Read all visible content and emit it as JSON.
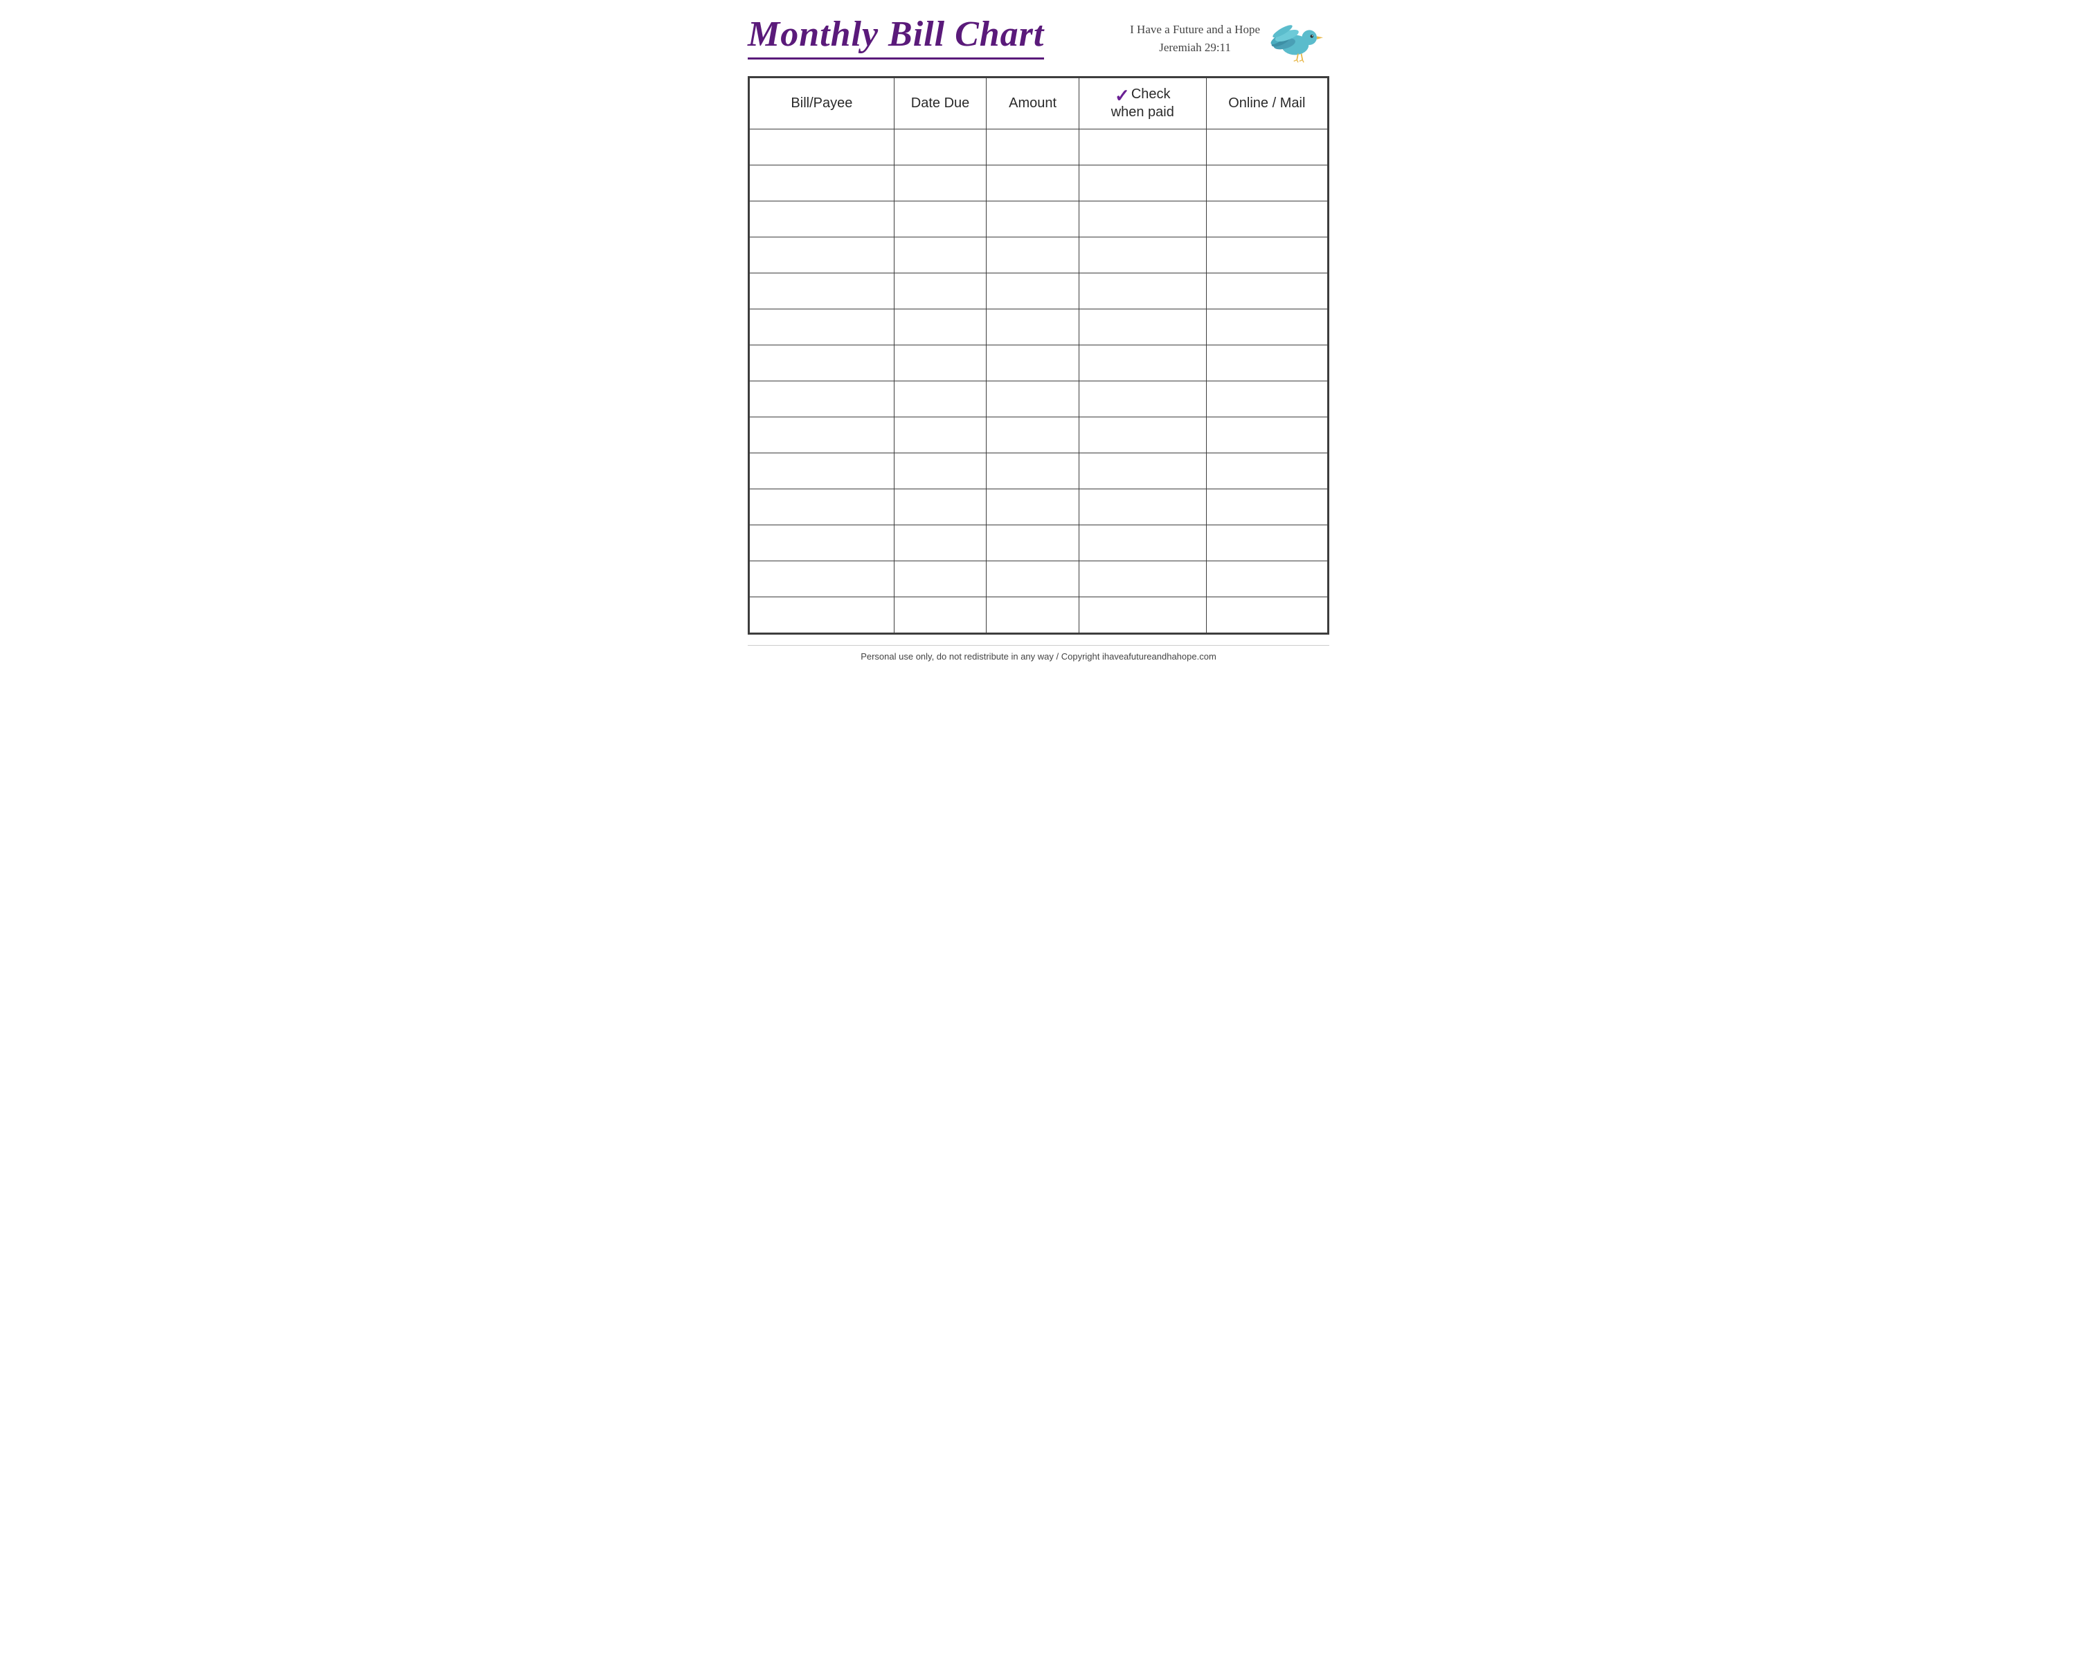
{
  "header": {
    "title": "Monthly Bill Chart",
    "subtitle_line1": "I Have a Future and a Hope",
    "subtitle_line2": "Jeremiah 29:11"
  },
  "table": {
    "columns": [
      {
        "id": "payee",
        "label": "Bill/Payee"
      },
      {
        "id": "date",
        "label": "Date Due"
      },
      {
        "id": "amount",
        "label": "Amount"
      },
      {
        "id": "check",
        "label": "Check when paid",
        "checkmark": "✓"
      },
      {
        "id": "online",
        "label": "Online / Mail"
      }
    ],
    "row_count": 14
  },
  "footer": {
    "text": "Personal use only, do not redistribute in any way / Copyright ihaveafutureandhahope.com"
  }
}
